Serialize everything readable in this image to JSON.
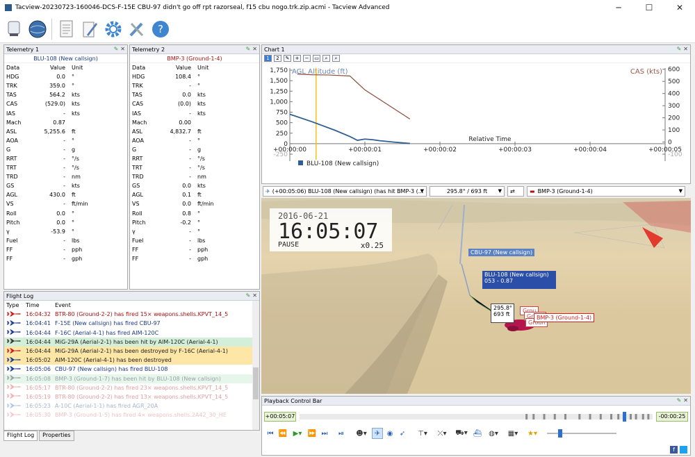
{
  "window": {
    "title": "Tacview-20230723-160046-DCS-F-15E CBU-97 didn't go off rpt razorseal, f15 cbu nogo.trk.zip.acmi - Tacview Advanced",
    "minimize": "─",
    "maximize": "☐",
    "close": "✕"
  },
  "colors": {
    "accent": "#3b7dd8",
    "hostile": "#b01010",
    "friendly": "#1a3a8a",
    "panel_header": "#e9ecf2"
  },
  "toolbar": {
    "icons": [
      "load-icon",
      "globe-icon",
      "document-icon",
      "edit-icon",
      "settings-icon",
      "tools-icon",
      "help-icon"
    ]
  },
  "telemetry1": {
    "header": "Telemetry 1",
    "subtitle": "BLU-108 (New callsign)",
    "columns": [
      "Data",
      "Value",
      "Unit"
    ],
    "rows": [
      [
        "HDG",
        "0.0",
        "°"
      ],
      [
        "TRK",
        "359.0",
        "°"
      ],
      [
        "TAS",
        "564.2",
        "kts"
      ],
      [
        "CAS",
        "(529.0)",
        "kts"
      ],
      [
        "IAS",
        "-",
        "kts"
      ],
      [
        "Mach",
        "0.87",
        ""
      ],
      [
        "ASL",
        "5,255.6",
        "ft"
      ],
      [
        "AOA",
        "-",
        "°"
      ],
      [
        "G",
        "-",
        "g"
      ],
      [
        "RRT",
        "-",
        "°/s"
      ],
      [
        "TRT",
        "-",
        "°/s"
      ],
      [
        "TRD",
        "-",
        "nm"
      ],
      [
        "GS",
        "-",
        "kts"
      ],
      [
        "AGL",
        "430.0",
        "ft"
      ],
      [
        "VS",
        "-",
        "ft/min"
      ],
      [
        "Roll",
        "0.0",
        "°"
      ],
      [
        "Pitch",
        "0.0",
        "°"
      ],
      [
        "γ",
        "-53.9",
        "°"
      ],
      [
        "Fuel",
        "-",
        "lbs"
      ],
      [
        "FF",
        "-",
        "pph"
      ],
      [
        "FF",
        "-",
        "gph"
      ]
    ]
  },
  "telemetry2": {
    "header": "Telemetry 2",
    "subtitle": "BMP-3 (Ground-1-4)",
    "columns": [
      "Data",
      "Value",
      "Unit"
    ],
    "rows": [
      [
        "HDG",
        "108.4",
        "°"
      ],
      [
        "TRK",
        "-",
        "°"
      ],
      [
        "TAS",
        "0.0",
        "kts"
      ],
      [
        "CAS",
        "(0.0)",
        "kts"
      ],
      [
        "IAS",
        "-",
        "kts"
      ],
      [
        "Mach",
        "0.00",
        ""
      ],
      [
        "ASL",
        "4,832.7",
        "ft"
      ],
      [
        "AOA",
        "-",
        "°"
      ],
      [
        "G",
        "-",
        "g"
      ],
      [
        "RRT",
        "-",
        "°/s"
      ],
      [
        "TRT",
        "-",
        "°/s"
      ],
      [
        "TRD",
        "-",
        "nm"
      ],
      [
        "GS",
        "0.0",
        "kts"
      ],
      [
        "AGL",
        "0.1",
        "ft"
      ],
      [
        "VS",
        "0.0",
        "ft/min"
      ],
      [
        "Roll",
        "0.8",
        "°"
      ],
      [
        "Pitch",
        "-0.2",
        "°"
      ],
      [
        "γ",
        "-",
        "°"
      ],
      [
        "Fuel",
        "-",
        "lbs"
      ],
      [
        "FF",
        "-",
        "pph"
      ],
      [
        "FF",
        "-",
        "gph"
      ]
    ]
  },
  "flightlog": {
    "header": "Flight Log",
    "columns": [
      "Type",
      "Time",
      "Event"
    ],
    "rows": [
      {
        "time": "16:04:32",
        "event": "BTR-80 (Ground-2-2) has fired 15× weapons.shells.KPVT_14_5",
        "color": "#b01010",
        "bg": "#ffffff",
        "icon": "#c81818"
      },
      {
        "time": "16:04:41",
        "event": "F-15E (New callsign) has fired CBU-97",
        "color": "#1a3a8a",
        "bg": "#ffffff",
        "icon": "#1a3a8a"
      },
      {
        "time": "16:04:44",
        "event": "F-16C (Aerial-4-1) has fired AIM-120C",
        "color": "#1a3a8a",
        "bg": "#ffffff",
        "icon": "#1a3a8a"
      },
      {
        "time": "16:04:44",
        "event": "MiG-29A (Aerial-2-1) has been hit by AIM-120C (Aerial-4-1)",
        "color": "#222222",
        "bg": "#d4efd9",
        "icon": "#333333"
      },
      {
        "time": "16:04:44",
        "event": "MiG-29A (Aerial-2-1) has been destroyed by F-16C (Aerial-4-1)",
        "color": "#222222",
        "bg": "#fde6a6",
        "icon": "#c81818"
      },
      {
        "time": "16:05:02",
        "event": "AIM-120C (Aerial-4-1) has been destroyed",
        "color": "#222222",
        "bg": "#fde6a6",
        "icon": "#1a3a8a"
      },
      {
        "time": "16:05:06",
        "event": "CBU-97 (New callsign) has fired BLU-108",
        "color": "#1a3a8a",
        "bg": "#ffffff",
        "icon": "#1a3a8a"
      },
      {
        "time": "16:05:08",
        "event": "BMP-3 (Ground-1-7) has been hit by BLU-108 (New callsign)",
        "color": "#9aa0aa",
        "bg": "#e7f6ea",
        "icon": "#9aa0aa"
      },
      {
        "time": "16:05:17",
        "event": "BTR-80 (Ground-2-2) has fired 23× weapons.shells.KPVT_14_5",
        "color": "#e3a0a0",
        "bg": "#ffffff",
        "icon": "#f0b0b0"
      },
      {
        "time": "16:05:19",
        "event": "BTR-80 (Ground-2-2) has fired 13× weapons.shells.KPVT_14_5",
        "color": "#e3a0a0",
        "bg": "#ffffff",
        "icon": "#f0b0b0"
      },
      {
        "time": "16:05:23",
        "event": "A-10C (Aerial-1-1) has fired AGR_20A",
        "color": "#a8b4cf",
        "bg": "#ffffff",
        "icon": "#b8c4df"
      },
      {
        "time": "16:05:30",
        "event": "BMP-3 (Ground-1-5) has fired 4× weapons.shells.2A42_30_HE",
        "color": "#ecc4c4",
        "bg": "#ffffff",
        "icon": "#f5caca"
      }
    ],
    "tabs": [
      "Flight Log",
      "Properties"
    ]
  },
  "chart": {
    "header": "Chart 1",
    "legend": "BLU-108 (New callsign)"
  },
  "chart_data": {
    "type": "line",
    "xlabel": "Relative Time",
    "x_ticks": [
      "+00:00:00",
      "+00:00:01",
      "+00:00:02",
      "+00:00:03",
      "+00:00:04",
      "+00:00:05"
    ],
    "xlim": [
      0,
      5
    ],
    "y_left": {
      "label": "AGL Altitude (ft)",
      "ticks": [
        "-250",
        "0",
        "250",
        "500",
        "750",
        "1,000",
        "1,250",
        "1,500",
        "1,750"
      ],
      "ylim": [
        -250,
        1800
      ]
    },
    "y_right": {
      "label": "CAS (kts)",
      "ticks": [
        "-100",
        "0",
        "100",
        "200",
        "300",
        "400",
        "500",
        "600"
      ],
      "ylim": [
        -100,
        610
      ]
    },
    "series": [
      {
        "name": "BLU-108 (New callsign)",
        "axis": "left",
        "color": "#2f5f94",
        "x": [
          0,
          0.3,
          0.6,
          0.8,
          0.9,
          1.0,
          1.1,
          1.2,
          1.4,
          1.6
        ],
        "y": [
          700,
          520,
          320,
          170,
          80,
          110,
          95,
          70,
          35,
          5
        ]
      },
      {
        "axis": "right",
        "color": "#8a4c3a",
        "x": [
          0.1,
          0.3,
          0.5,
          0.8,
          1.0,
          1.2,
          1.4,
          1.6
        ],
        "y": [
          560,
          555,
          553,
          545,
          430,
          350,
          270,
          190
        ]
      }
    ],
    "cursor_x": 0.35,
    "grid": true
  },
  "selector": {
    "event": "(+00:05:06) BLU-108 (New callsign) (has hit BMP-3 (...",
    "bearing": "295.8° / 693 ft",
    "target": "BMP-3 (Ground-1-4)"
  },
  "view3d": {
    "date": "2016-06-21",
    "time": "16:05:07",
    "state": "PAUSE",
    "speed": "x0.25",
    "label_cbu": "CBU-97 (New callsign)",
    "label_blu": "BLU-108 (New callsign)",
    "label_blu_info": "053 - 0.87",
    "label_dist1": "295.8°",
    "label_dist2": "693 ft",
    "label_target": "BMP-3 (Ground-1-4)",
    "label_ground1": "Grou",
    "label_ground2": "Groun",
    "label_ground3": "Groun"
  },
  "playback": {
    "header": "Playback Control Bar",
    "time_start": "+00:05:07",
    "time_end": "-00:00:25",
    "progress": 0.92
  }
}
